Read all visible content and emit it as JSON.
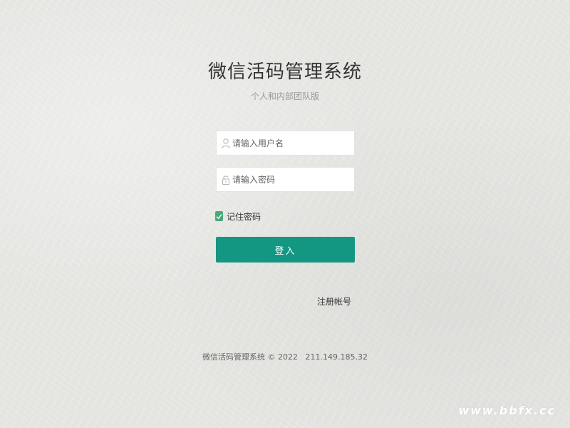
{
  "app": {
    "title": "微信活码管理系统",
    "subtitle": "个人和内部团队版"
  },
  "login_form": {
    "username_placeholder": "请输入用户名",
    "username_value": "",
    "username_icon": "user-icon",
    "password_placeholder": "请输入密码",
    "password_value": "",
    "password_icon": "lock-icon",
    "remember_label": "记住密码",
    "remember_checked": true,
    "submit_label": "登入"
  },
  "links": {
    "register_label": "注册帐号"
  },
  "footer": {
    "text": "微信活码管理系统 © 2022   211.149.185.32"
  },
  "watermark": {
    "text": "www.bbfx.cc"
  },
  "colors": {
    "primary": "#139682",
    "checkbox": "#4aa87a",
    "background": "#e6e6e3",
    "title_text": "#333333",
    "subtitle_text": "#9a9a9a"
  }
}
